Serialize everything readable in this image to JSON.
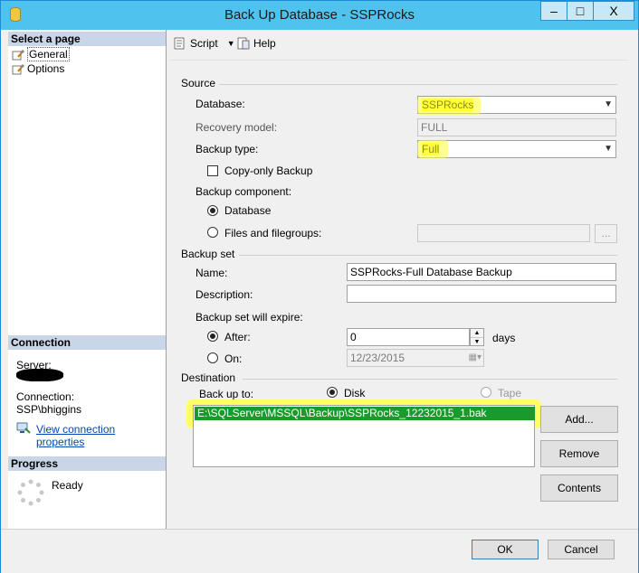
{
  "window": {
    "title": "Back Up Database - SSPRocks",
    "minimize": "‒",
    "maximize": "□",
    "close": "X"
  },
  "left": {
    "select_page_header": "Select a page",
    "pages": [
      {
        "label": "General",
        "icon": "wrench-page-icon"
      },
      {
        "label": "Options",
        "icon": "wrench-page-icon"
      }
    ],
    "connection_header": "Connection",
    "server_label": "Server:",
    "connection_label": "Connection:",
    "connection_value": "SSP\\bhiggins",
    "view_props_link": "View connection properties",
    "progress_header": "Progress",
    "progress_status": "Ready"
  },
  "toolbar": {
    "script_label": "Script",
    "help_label": "Help"
  },
  "source": {
    "group_label": "Source",
    "database_label": "Database:",
    "database_value": "SSPRocks",
    "recovery_label": "Recovery model:",
    "recovery_value": "FULL",
    "backup_type_label": "Backup type:",
    "backup_type_value": "Full",
    "copy_only_label": "Copy-only Backup",
    "component_label": "Backup component:",
    "component_database": "Database",
    "component_files": "Files and filegroups:",
    "browse_label": "..."
  },
  "backup_set": {
    "group_label": "Backup set",
    "name_label": "Name:",
    "name_value": "SSPRocks-Full Database Backup",
    "description_label": "Description:",
    "description_value": "",
    "expire_label": "Backup set will expire:",
    "after_label": "After:",
    "after_value": "0",
    "days_label": "days",
    "on_label": "On:",
    "on_value": "12/23/2015"
  },
  "destination": {
    "group_label": "Destination",
    "backup_to_label": "Back up to:",
    "disk_label": "Disk",
    "tape_label": "Tape",
    "paths": [
      "E:\\SQLServer\\MSSQL\\Backup\\SSPRocks_12232015_1.bak"
    ],
    "add_label": "Add...",
    "remove_label": "Remove",
    "contents_label": "Contents"
  },
  "buttons": {
    "ok": "OK",
    "cancel": "Cancel"
  },
  "colors": {
    "titlebar": "#4fc3ee",
    "highlight": "#ffff33",
    "selected_row": "#1a9a2a",
    "link": "#0645ad"
  }
}
